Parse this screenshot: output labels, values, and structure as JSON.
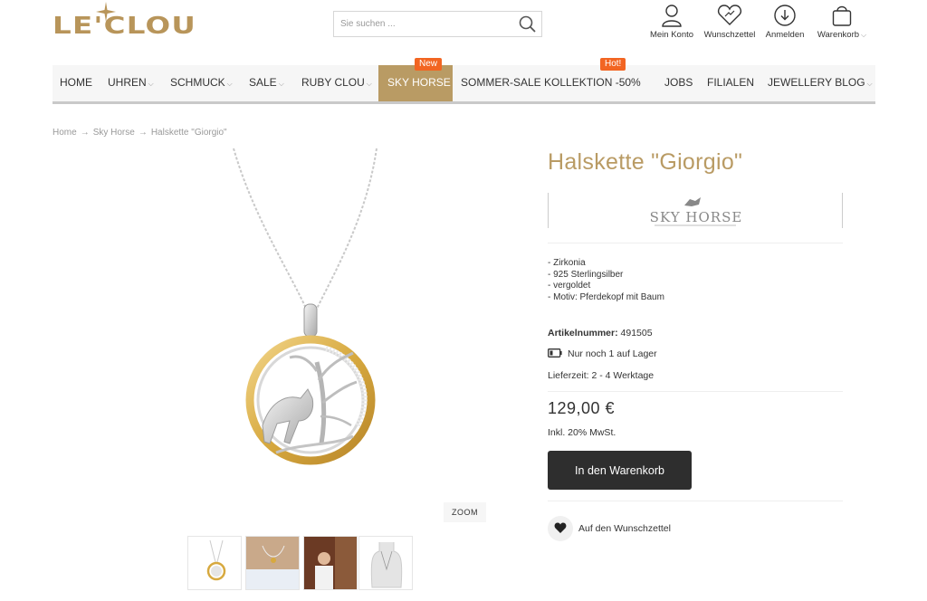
{
  "logo": {
    "text": "LE'CLOU"
  },
  "search": {
    "placeholder": "Sie suchen ..."
  },
  "account_links": [
    {
      "label": "Mein Konto",
      "icon": "user-icon"
    },
    {
      "label": "Wunschzettel",
      "icon": "heart-icon"
    },
    {
      "label": "Anmelden",
      "icon": "login-icon"
    },
    {
      "label": "Warenkorb",
      "icon": "bag-icon"
    }
  ],
  "nav": {
    "items": [
      {
        "label": "HOME"
      },
      {
        "label": "UHREN"
      },
      {
        "label": "SCHMUCK"
      },
      {
        "label": "SALE"
      },
      {
        "label": "RUBY CLOU"
      },
      {
        "label": "SKY HORSE",
        "badge": "New"
      },
      {
        "label": "SOMMER-SALE KOLLEKTION -50%",
        "badge": "Hot!"
      },
      {
        "label": "JOBS"
      },
      {
        "label": "FILIALEN"
      },
      {
        "label": "JEWELLERY BLOG"
      }
    ]
  },
  "breadcrumb": [
    "Home",
    "Sky Horse",
    "Halskette \"Giorgio\""
  ],
  "product": {
    "title": "Halskette \"Giorgio\"",
    "brand": "SKY HORSE",
    "features": [
      "- Zirkonia",
      "- 925 Sterlingsilber",
      "- vergoldet",
      "- Motiv: Pferdekopf mit Baum"
    ],
    "artnr_label": "Artikelnummer:",
    "artnr_value": "491505",
    "stock": "Nur noch 1 auf Lager",
    "lieferzeit": "Lieferzeit: 2 - 4 Werktage",
    "price": "129,00 €",
    "tax": "Inkl. 20% MwSt.",
    "cart_button": "In den Warenkorb",
    "wishlist": "Auf den Wunschzettel",
    "zoom": "ZOOM"
  },
  "colors": {
    "gold": "#b99b64",
    "badge": "#f26522",
    "button": "#2e2e2e"
  }
}
